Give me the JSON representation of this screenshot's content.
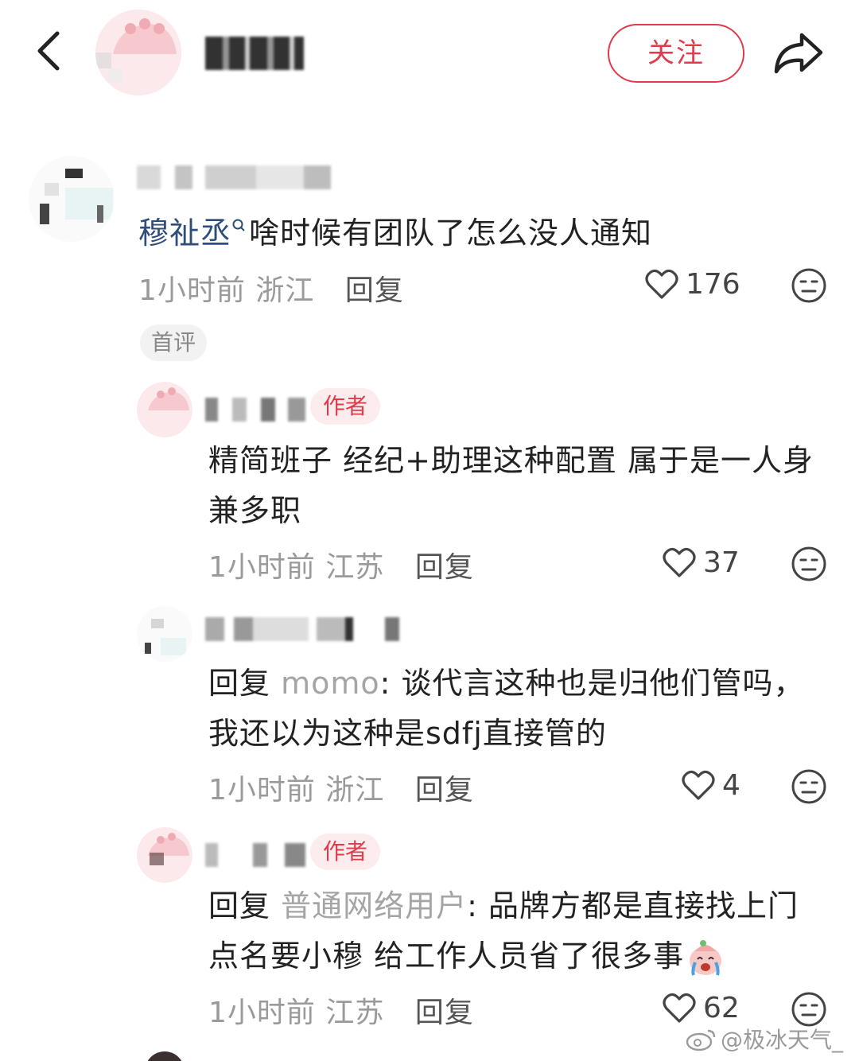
{
  "header": {
    "follow_label": "关注"
  },
  "comments": [
    {
      "mention": "穆祉丞",
      "text": "啥时候有团队了怎么没人通知",
      "time": "1小时前",
      "location": "浙江",
      "reply_label": "回复",
      "likes": "176",
      "badge": "首评"
    },
    {
      "author_tag": "作者",
      "text_line1": "精简班子 经纪+助理这种配置 属于是一人身",
      "text_line2": "兼多职",
      "time": "1小时前",
      "location": "江苏",
      "reply_label": "回复",
      "likes": "37"
    },
    {
      "reply_prefix": "回复",
      "reply_to": "momo",
      "text_line1": ": 谈代言这种也是归他们管吗，",
      "text_line2": "我还以为这种是sdfj直接管的",
      "time": "1小时前",
      "location": "浙江",
      "reply_label": "回复",
      "likes": "4"
    },
    {
      "author_tag": "作者",
      "reply_prefix": "回复",
      "reply_to": "普通网络用户",
      "text_line1": ": 品牌方都是直接找上门",
      "text_line2": "点名要小穆 给工作人员省了很多事",
      "time": "1小时前",
      "location": "江苏",
      "reply_label": "回复",
      "likes": "62"
    }
  ],
  "watermark": "@极冰天气_",
  "colors": {
    "accent": "#e03a4b",
    "mention": "#2f4d7a",
    "muted": "#9a9a9a"
  }
}
